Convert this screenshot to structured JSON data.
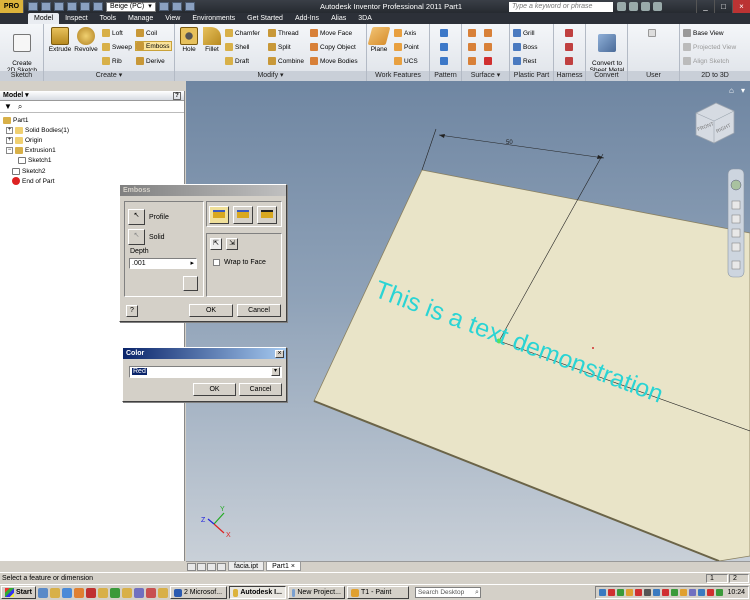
{
  "titlebar": {
    "app_button": "PRO",
    "appearance_combo": "Beige (PC)",
    "title": "Autodesk Inventor Professional 2011    Part1",
    "search_placeholder": "Type a keyword or phrase"
  },
  "ribbon_tabs": [
    "Model",
    "Inspect",
    "Tools",
    "Manage",
    "View",
    "Environments",
    "Get Started",
    "Add-Ins",
    "Alias",
    "3DA"
  ],
  "ribbon": {
    "sketch": {
      "label": "Sketch",
      "create_2d_sketch": "Create\n2D Sketch"
    },
    "create": {
      "label": "Create",
      "extrude": "Extrude",
      "revolve": "Revolve",
      "loft": "Loft",
      "sweep": "Sweep",
      "rib": "Rib",
      "coil": "Coil",
      "emboss": "Emboss",
      "derive": "Derive"
    },
    "modify": {
      "label": "Modify",
      "hole": "Hole",
      "fillet": "Fillet",
      "chamfer": "Chamfer",
      "shell": "Shell",
      "draft": "Draft",
      "thread": "Thread",
      "split": "Split",
      "combine": "Combine",
      "move_face": "Move Face",
      "copy_object": "Copy Object",
      "move_bodies": "Move Bodies"
    },
    "work_features": {
      "label": "Work Features",
      "plane": "Plane",
      "axis": "Axis",
      "point": "Point",
      "ucs": "UCS"
    },
    "pattern": {
      "label": "Pattern"
    },
    "surface": {
      "label": "Surface"
    },
    "plastic_part": {
      "label": "Plastic Part",
      "grill": "Grill",
      "boss": "Boss",
      "rest": "Rest"
    },
    "harness": {
      "label": "Harness"
    },
    "convert": {
      "label": "Convert",
      "convert_to_sheet_metal": "Convert to\nSheet Metal"
    },
    "user_commands": {
      "label": "User Commands"
    },
    "2d_to_3d": {
      "label": "2D to 3D",
      "base_view": "Base View",
      "projected_view": "Projected View",
      "align_sketch": "Align Sketch"
    }
  },
  "model_panel": {
    "title": "Model",
    "tree": [
      "Part1",
      "Solid Bodies(1)",
      "Origin",
      "Extrusion1",
      "Sketch1",
      "Sketch2",
      "End of Part"
    ]
  },
  "viewport": {
    "dimension": "50",
    "text": "This is a text demonstration",
    "viewcube_front": "FRONT",
    "viewcube_right": "RIGHT",
    "text_color": "#2ad4d4",
    "plate_color": "#e9e4c8"
  },
  "emboss_dialog": {
    "title": "Emboss",
    "profile": "Profile",
    "solid": "Solid",
    "depth_label": "Depth",
    "depth_value": ".001",
    "wrap_to_face": "Wrap to Face",
    "ok": "OK",
    "cancel": "Cancel",
    "help": "?"
  },
  "color_dialog": {
    "title": "Color",
    "value": "Red",
    "ok": "OK",
    "cancel": "Cancel"
  },
  "doc_tabs": [
    "facia.ipt",
    "Part1"
  ],
  "status": {
    "message": "Select a feature or dimension",
    "count1": "1",
    "count2": "2"
  },
  "taskbar": {
    "start": "Start",
    "tasks": [
      "2 Microsof...",
      "Autodesk I...",
      "New Project...",
      "T1 - Paint"
    ],
    "search": "Search Desktop",
    "clock": "10:24"
  }
}
